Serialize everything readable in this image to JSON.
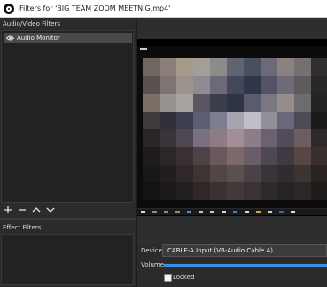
{
  "window": {
    "title": "Filters for 'BIG TEAM ZOOM MEETNIG.mp4'"
  },
  "left_panel": {
    "audio_video_title": "Audio/Video Filters",
    "filters": [
      {
        "label": "Audio Monitor",
        "icon": "eye-icon"
      }
    ],
    "toolbar": [
      {
        "name": "add-filter-button",
        "symbol": "+"
      },
      {
        "name": "remove-filter-button",
        "symbol": "−"
      },
      {
        "name": "move-up-button",
        "symbol": "^"
      },
      {
        "name": "move-down-button",
        "symbol": "v"
      }
    ],
    "effect_title": "Effect Filters"
  },
  "preview": {
    "description_icon": "video-preview"
  },
  "properties": {
    "device_label": "Device",
    "device_value": "CABLE-A Input (VB-Audio Cable A)",
    "volume_label": "Volume",
    "volume_level": 1.0,
    "locked_label": "Locked",
    "locked_checked": false
  },
  "colors": {
    "accent": "#1e72c7",
    "selection": "#4a4a4a",
    "panel": "#2b2b2b"
  }
}
